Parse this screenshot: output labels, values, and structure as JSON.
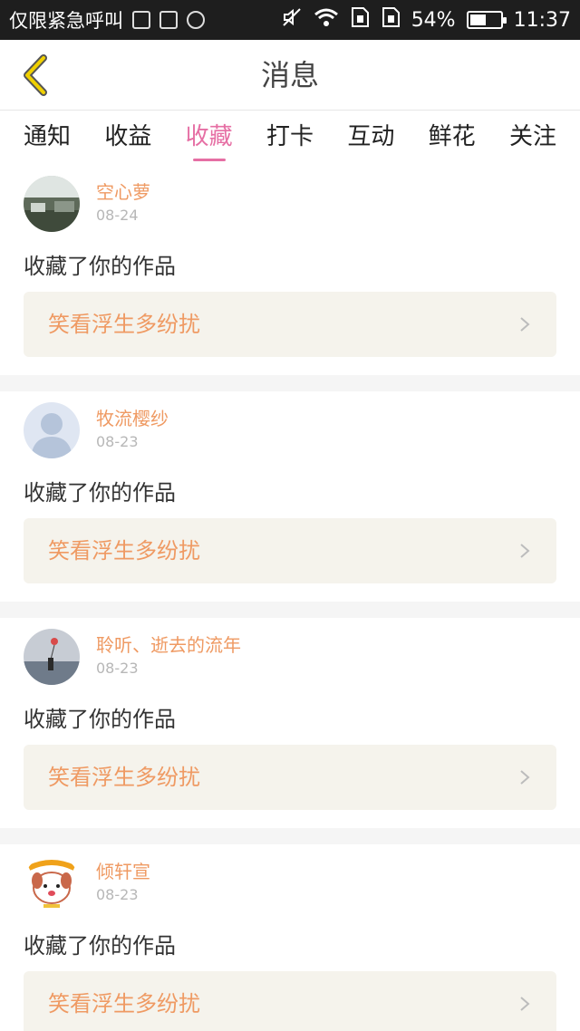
{
  "status_bar": {
    "carrier": "仅限紧急呼叫",
    "battery": "54%",
    "battery_level": 0.54,
    "time": "11:37"
  },
  "header": {
    "title": "消息"
  },
  "tabs": [
    {
      "label": "通知",
      "active": false
    },
    {
      "label": "收益",
      "active": false
    },
    {
      "label": "收藏",
      "active": true
    },
    {
      "label": "打卡",
      "active": false
    },
    {
      "label": "互动",
      "active": false
    },
    {
      "label": "鲜花",
      "active": false
    },
    {
      "label": "关注",
      "active": false
    }
  ],
  "messages": [
    {
      "user": "空心萝",
      "date": "08-24",
      "action": "收藏了你的作品",
      "work": "笑看浮生多纷扰"
    },
    {
      "user": "牧流樱纱",
      "date": "08-23",
      "action": "收藏了你的作品",
      "work": "笑看浮生多纷扰"
    },
    {
      "user": "聆听、逝去的流年",
      "date": "08-23",
      "action": "收藏了你的作品",
      "work": "笑看浮生多纷扰"
    },
    {
      "user": "倾轩宣",
      "date": "08-23",
      "action": "收藏了你的作品",
      "work": "笑看浮生多纷扰"
    }
  ],
  "colors": {
    "accent": "#e66fa4",
    "name": "#ef9a63",
    "back": "#f0d000"
  }
}
